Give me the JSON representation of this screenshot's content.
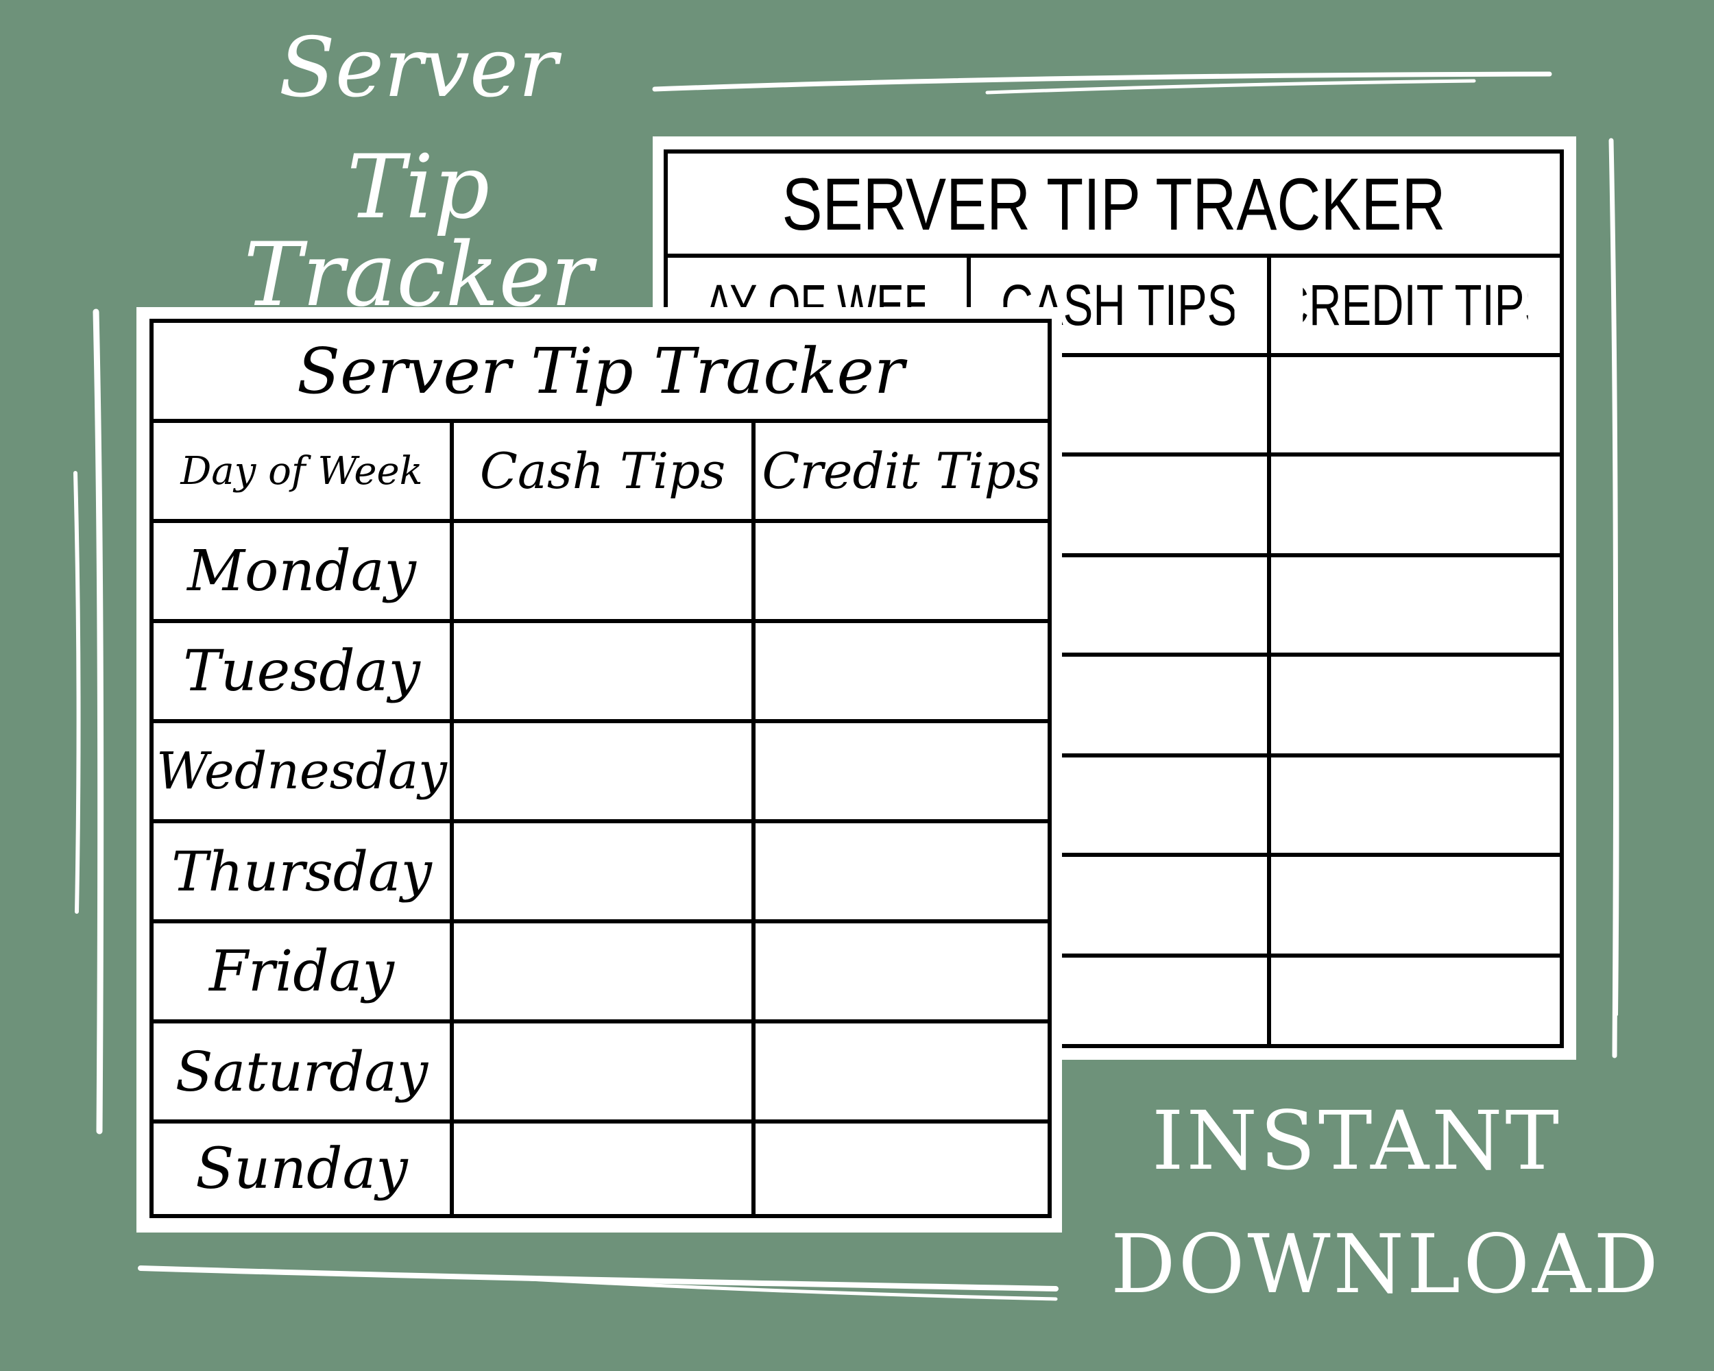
{
  "colors": {
    "background": "#6e927a",
    "page": "#ffffff",
    "ink": "#000000",
    "accent_text": "#ffffff"
  },
  "hero": {
    "line1": "Server",
    "line2": "Tip Tracker"
  },
  "back_sheet": {
    "title": "SERVER TIP TRACKER",
    "headers": [
      "DAY OF WEEK",
      "CASH TIPS",
      "CREDIT TIPS"
    ],
    "row_count": 7
  },
  "front_sheet": {
    "title": "Server Tip Tracker",
    "headers": [
      "Day of Week",
      "Cash Tips",
      "Credit Tips"
    ],
    "rows": [
      {
        "day": "Monday",
        "cash": "",
        "credit": ""
      },
      {
        "day": "Tuesday",
        "cash": "",
        "credit": ""
      },
      {
        "day": "Wednesday",
        "cash": "",
        "credit": ""
      },
      {
        "day": "Thursday",
        "cash": "",
        "credit": ""
      },
      {
        "day": "Friday",
        "cash": "",
        "credit": ""
      },
      {
        "day": "Saturday",
        "cash": "",
        "credit": ""
      },
      {
        "day": "Sunday",
        "cash": "",
        "credit": ""
      }
    ]
  },
  "badge": {
    "line1": "INSTANT",
    "line2": "DOWNLOAD"
  }
}
